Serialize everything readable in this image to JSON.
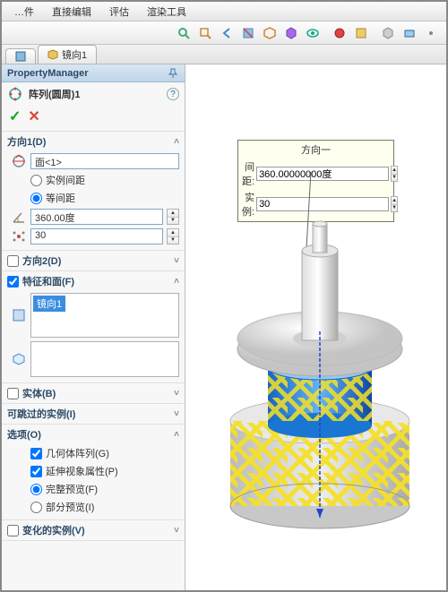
{
  "menu": {
    "m1": "…件",
    "m2": "直接编辑",
    "m3": "评估",
    "m4": "渲染工具"
  },
  "tab": {
    "label": "镜向1"
  },
  "pm": {
    "title": "PropertyManager",
    "feature_name": "阵列(圆周)1",
    "ok": "✓",
    "cancel": "✕",
    "dir1": {
      "title": "方向1(D)",
      "axis_value": "面<1>",
      "r1": "实例间距",
      "r2": "等间距",
      "angle": "360.00度",
      "count": "30"
    },
    "dir2": {
      "title": "方向2(D)"
    },
    "feat": {
      "title": "特征和面(F)",
      "item": "镜向1"
    },
    "body": {
      "title": "实体(B)"
    },
    "skip": {
      "title": "可跳过的实例(I)"
    },
    "opts": {
      "title": "选项(O)",
      "o1": "几何体阵列(G)",
      "o2": "延伸视象属性(P)",
      "o3": "完整预览(F)",
      "o4": "部分预览(I)"
    },
    "vary": {
      "title": "变化的实例(V)"
    }
  },
  "callout": {
    "title": "方向一",
    "spacing_label": "间距:",
    "spacing_value": "360.00000000度",
    "inst_label": "实例:",
    "inst_value": "30"
  }
}
